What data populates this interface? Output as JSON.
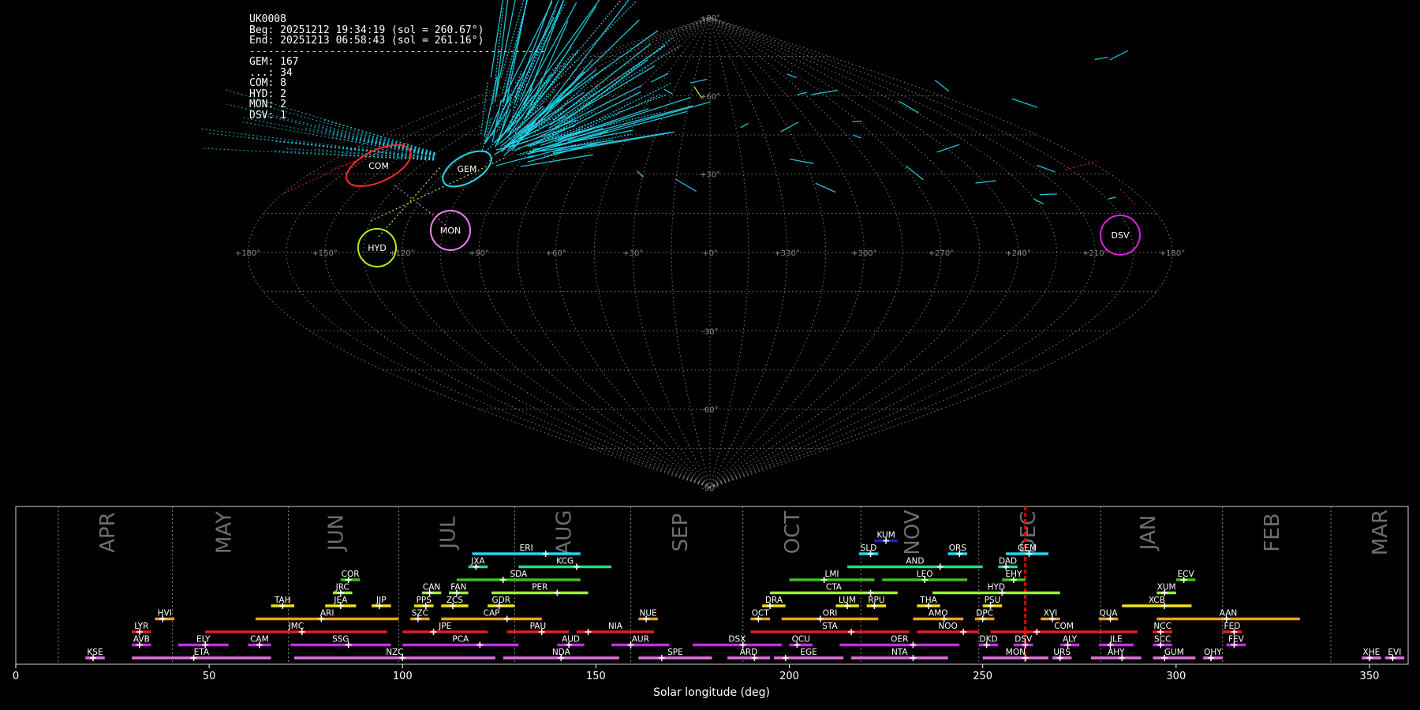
{
  "info": {
    "station": "UK0008",
    "begin": "Beg: 20251212 19:34:19 (sol = 260.67°)",
    "end": "End: 20251213 06:58:43 (sol = 261.16°)",
    "separator": "------------------------------------------------",
    "counts": [
      {
        "label": "GEM",
        "value": 167
      },
      {
        "label": "...",
        "value": 34
      },
      {
        "label": "COM",
        "value": 8
      },
      {
        "label": "HYD",
        "value": 2
      },
      {
        "label": "MON",
        "value": 2
      },
      {
        "label": "DSV",
        "value": 1
      }
    ]
  },
  "sky_map": {
    "projection": "sinusoidal",
    "ra_labels": [
      "+180°",
      "+150°",
      "+120°",
      "+90°",
      "+60°",
      "+30°",
      "+0°",
      "+330°",
      "+300°",
      "+270°",
      "+240°",
      "+210°",
      "+180°"
    ],
    "dec_labels": [
      "+90°",
      "+60°",
      "+30°",
      "-30°",
      "-60°",
      "-90°"
    ],
    "radiants": [
      {
        "name": "COM",
        "ra": 163,
        "dec": 32,
        "color": "#ff2a2a"
      },
      {
        "name": "GEM",
        "ra": 112,
        "dec": 32,
        "color": "#22d8f0"
      },
      {
        "name": "HYD",
        "ra": 130,
        "dec": 3,
        "color": "#b0f020"
      },
      {
        "name": "MON",
        "ra": 101,
        "dec": 9,
        "color": "#f080f0"
      },
      {
        "name": "DSV",
        "ra": 225,
        "dec": 7,
        "color": "#e020e0"
      }
    ],
    "colors": {
      "gem": "#22d8f0",
      "sporadic": "#ff2a2a",
      "hyd": "#c8f020",
      "mon": "#f070e0",
      "grid": "#9a9a9a"
    }
  },
  "chart_data": {
    "type": "timeline",
    "xlabel": "Solar longitude (deg)",
    "xlim": [
      0,
      360
    ],
    "x_ticks": [
      0,
      50,
      100,
      150,
      200,
      250,
      300,
      350
    ],
    "current_sol": 261,
    "months": [
      {
        "name": "APR",
        "start": 11,
        "label_at": 24
      },
      {
        "name": "MAY",
        "start": 40.5,
        "label_at": 54
      },
      {
        "name": "JUN",
        "start": 70.5,
        "label_at": 83
      },
      {
        "name": "JUL",
        "start": 99,
        "label_at": 112
      },
      {
        "name": "AUG",
        "start": 129,
        "label_at": 142
      },
      {
        "name": "SEP",
        "start": 159,
        "label_at": 172
      },
      {
        "name": "OCT",
        "start": 188,
        "label_at": 201
      },
      {
        "name": "NOV",
        "start": 218.5,
        "label_at": 232
      },
      {
        "name": "DEC",
        "start": 249,
        "label_at": 262
      },
      {
        "name": "JAN",
        "start": 280.5,
        "label_at": 293
      },
      {
        "name": "FEB",
        "start": 312,
        "label_at": 325
      },
      {
        "name": "MAR",
        "start": 340,
        "label_at": 353
      }
    ],
    "showers": [
      {
        "code": "KUM",
        "start": 222,
        "end": 228,
        "peak": 225,
        "level": 9,
        "color": "#2020e0"
      },
      {
        "code": "ERI",
        "start": 118,
        "end": 146,
        "peak": 137,
        "level": 8,
        "color": "#22d8f0"
      },
      {
        "code": "SLD",
        "start": 218,
        "end": 223,
        "peak": 221,
        "level": 8,
        "color": "#22d8f0"
      },
      {
        "code": "ORS",
        "start": 241,
        "end": 246,
        "peak": 244,
        "level": 8,
        "color": "#22d8f0"
      },
      {
        "code": "GEM",
        "start": 256,
        "end": 267,
        "peak": 262,
        "level": 8,
        "color": "#22d8f0"
      },
      {
        "code": "JXA",
        "start": 117,
        "end": 122,
        "peak": 119,
        "level": 7,
        "color": "#20e080"
      },
      {
        "code": "KCG",
        "start": 130,
        "end": 154,
        "peak": 145,
        "level": 7,
        "color": "#20e080"
      },
      {
        "code": "AND",
        "start": 215,
        "end": 250,
        "peak": 239,
        "level": 7,
        "color": "#20e080"
      },
      {
        "code": "DAD",
        "start": 254,
        "end": 259,
        "peak": 256,
        "level": 7,
        "color": "#20e080"
      },
      {
        "code": "COR",
        "start": 84,
        "end": 89,
        "peak": 86,
        "level": 6,
        "color": "#40c020"
      },
      {
        "code": "SDA",
        "start": 114,
        "end": 146,
        "peak": 126,
        "level": 6,
        "color": "#40c020"
      },
      {
        "code": "LMI",
        "start": 200,
        "end": 222,
        "peak": 209,
        "level": 6,
        "color": "#40c020"
      },
      {
        "code": "LEO",
        "start": 224,
        "end": 246,
        "peak": 235,
        "level": 6,
        "color": "#40c020"
      },
      {
        "code": "EHY",
        "start": 255,
        "end": 261,
        "peak": 258,
        "level": 6,
        "color": "#40c020"
      },
      {
        "code": "ECV",
        "start": 300,
        "end": 305,
        "peak": 302,
        "level": 6,
        "color": "#40c020"
      },
      {
        "code": "JRC",
        "start": 82,
        "end": 87,
        "peak": 84,
        "level": 5,
        "color": "#a0f030"
      },
      {
        "code": "CAN",
        "start": 105,
        "end": 110,
        "peak": 107,
        "level": 5,
        "color": "#a0f030"
      },
      {
        "code": "FAN",
        "start": 112,
        "end": 117,
        "peak": 114,
        "level": 5,
        "color": "#a0f030"
      },
      {
        "code": "PER",
        "start": 123,
        "end": 148,
        "peak": 140,
        "level": 5,
        "color": "#a0f030"
      },
      {
        "code": "CTA",
        "start": 195,
        "end": 228,
        "peak": 221,
        "level": 5,
        "color": "#a0f030"
      },
      {
        "code": "HYD",
        "start": 237,
        "end": 270,
        "peak": 255,
        "level": 5,
        "color": "#a0f030"
      },
      {
        "code": "XUM",
        "start": 295,
        "end": 300,
        "peak": 297,
        "level": 5,
        "color": "#a0f030"
      },
      {
        "code": "TAH",
        "start": 66,
        "end": 72,
        "peak": 69,
        "level": 4,
        "color": "#f0e020"
      },
      {
        "code": "JEA",
        "start": 80,
        "end": 88,
        "peak": 84,
        "level": 4,
        "color": "#f0e020"
      },
      {
        "code": "JIP",
        "start": 92,
        "end": 97,
        "peak": 94,
        "level": 4,
        "color": "#f0e020"
      },
      {
        "code": "PPS",
        "start": 103,
        "end": 108,
        "peak": 106,
        "level": 4,
        "color": "#f0e020"
      },
      {
        "code": "ZCS",
        "start": 110,
        "end": 117,
        "peak": 113,
        "level": 4,
        "color": "#f0e020"
      },
      {
        "code": "GDR",
        "start": 122,
        "end": 129,
        "peak": 125,
        "level": 4,
        "color": "#f0e020"
      },
      {
        "code": "DRA",
        "start": 193,
        "end": 199,
        "peak": 195,
        "level": 4,
        "color": "#f0e020"
      },
      {
        "code": "LUM",
        "start": 212,
        "end": 218,
        "peak": 215,
        "level": 4,
        "color": "#f0e020"
      },
      {
        "code": "RPU",
        "start": 220,
        "end": 225,
        "peak": 222,
        "level": 4,
        "color": "#f0e020"
      },
      {
        "code": "THA",
        "start": 233,
        "end": 239,
        "peak": 236,
        "level": 4,
        "color": "#f0e020"
      },
      {
        "code": "PSU",
        "start": 250,
        "end": 255,
        "peak": 252,
        "level": 4,
        "color": "#f0e020"
      },
      {
        "code": "XCB",
        "start": 286,
        "end": 304,
        "peak": 297,
        "level": 4,
        "color": "#f0e020"
      },
      {
        "code": "HVI",
        "start": 36,
        "end": 41,
        "peak": 38,
        "level": 3,
        "color": "#f0a020"
      },
      {
        "code": "ARI",
        "start": 62,
        "end": 99,
        "peak": 79,
        "level": 3,
        "color": "#f0a020"
      },
      {
        "code": "SZC",
        "start": 102,
        "end": 107,
        "peak": 104,
        "level": 3,
        "color": "#f0a020"
      },
      {
        "code": "CAP",
        "start": 110,
        "end": 136,
        "peak": 127,
        "level": 3,
        "color": "#f0a020"
      },
      {
        "code": "NUE",
        "start": 161,
        "end": 166,
        "peak": 163,
        "level": 3,
        "color": "#f0a020"
      },
      {
        "code": "OCT",
        "start": 190,
        "end": 195,
        "peak": 192,
        "level": 3,
        "color": "#f0a020"
      },
      {
        "code": "ORI",
        "start": 198,
        "end": 223,
        "peak": 208,
        "level": 3,
        "color": "#f0a020"
      },
      {
        "code": "AMO",
        "start": 232,
        "end": 245,
        "peak": 240,
        "level": 3,
        "color": "#f0a020"
      },
      {
        "code": "DPC",
        "start": 248,
        "end": 253,
        "peak": 250,
        "level": 3,
        "color": "#f0a020"
      },
      {
        "code": "XVI",
        "start": 265,
        "end": 270,
        "peak": 268,
        "level": 3,
        "color": "#f0a020"
      },
      {
        "code": "QUA",
        "start": 280,
        "end": 285,
        "peak": 283,
        "level": 3,
        "color": "#f0a020"
      },
      {
        "code": "AAN",
        "start": 295,
        "end": 332,
        "peak": 313,
        "level": 3,
        "color": "#f0a020"
      },
      {
        "code": "LYR",
        "start": 30,
        "end": 35,
        "peak": 32,
        "level": 2,
        "color": "#e02020"
      },
      {
        "code": "JMC",
        "start": 49,
        "end": 96,
        "peak": 74,
        "level": 2,
        "color": "#e02020"
      },
      {
        "code": "JPE",
        "start": 100,
        "end": 122,
        "peak": 108,
        "level": 2,
        "color": "#e02020"
      },
      {
        "code": "PAU",
        "start": 127,
        "end": 143,
        "peak": 136,
        "level": 2,
        "color": "#e02020"
      },
      {
        "code": "NIA",
        "start": 145,
        "end": 165,
        "peak": 148,
        "level": 2,
        "color": "#e02020"
      },
      {
        "code": "STA",
        "start": 190,
        "end": 231,
        "peak": 216,
        "level": 2,
        "color": "#e02020"
      },
      {
        "code": "NOO",
        "start": 233,
        "end": 249,
        "peak": 245,
        "level": 2,
        "color": "#e02020"
      },
      {
        "code": "COM",
        "start": 252,
        "end": 290,
        "peak": 264,
        "level": 2,
        "color": "#e02020"
      },
      {
        "code": "NCC",
        "start": 294,
        "end": 299,
        "peak": 296,
        "level": 2,
        "color": "#e02020"
      },
      {
        "code": "FED",
        "start": 312,
        "end": 317,
        "peak": 315,
        "level": 2,
        "color": "#e02020"
      },
      {
        "code": "AVB",
        "start": 30,
        "end": 35,
        "peak": 32,
        "level": 1,
        "color": "#c030e0"
      },
      {
        "code": "ELY",
        "start": 42,
        "end": 55,
        "peak": 49,
        "level": 1,
        "color": "#c030e0"
      },
      {
        "code": "CAM",
        "start": 60,
        "end": 66,
        "peak": 63,
        "level": 1,
        "color": "#c030e0"
      },
      {
        "code": "SSG",
        "start": 71,
        "end": 97,
        "peak": 86,
        "level": 1,
        "color": "#c030e0"
      },
      {
        "code": "PCA",
        "start": 100,
        "end": 130,
        "peak": 120,
        "level": 1,
        "color": "#c030e0"
      },
      {
        "code": "AUD",
        "start": 140,
        "end": 147,
        "peak": 143,
        "level": 1,
        "color": "#c030e0"
      },
      {
        "code": "AUR",
        "start": 154,
        "end": 169,
        "peak": 159,
        "level": 1,
        "color": "#c030e0"
      },
      {
        "code": "DSX",
        "start": 175,
        "end": 198,
        "peak": 188,
        "level": 1,
        "color": "#c030e0"
      },
      {
        "code": "OCU",
        "start": 200,
        "end": 206,
        "peak": 202,
        "level": 1,
        "color": "#c030e0"
      },
      {
        "code": "OER",
        "start": 213,
        "end": 244,
        "peak": 232,
        "level": 1,
        "color": "#c030e0"
      },
      {
        "code": "DKD",
        "start": 249,
        "end": 254,
        "peak": 251,
        "level": 1,
        "color": "#c030e0"
      },
      {
        "code": "DSV",
        "start": 258,
        "end": 263,
        "peak": 261,
        "level": 1,
        "color": "#c030e0"
      },
      {
        "code": "ALY",
        "start": 270,
        "end": 275,
        "peak": 272,
        "level": 1,
        "color": "#c030e0"
      },
      {
        "code": "JLE",
        "start": 280,
        "end": 289,
        "peak": 283,
        "level": 1,
        "color": "#c030e0"
      },
      {
        "code": "SCC",
        "start": 294,
        "end": 299,
        "peak": 296,
        "level": 1,
        "color": "#c030e0"
      },
      {
        "code": "FEV",
        "start": 313,
        "end": 318,
        "peak": 315,
        "level": 1,
        "color": "#c030e0"
      },
      {
        "code": "KSE",
        "start": 18,
        "end": 23,
        "peak": 20,
        "level": 0,
        "color": "#e070e0"
      },
      {
        "code": "ETA",
        "start": 30,
        "end": 66,
        "peak": 46,
        "level": 0,
        "color": "#e070e0"
      },
      {
        "code": "NZC",
        "start": 72,
        "end": 124,
        "peak": 100,
        "level": 0,
        "color": "#e070e0"
      },
      {
        "code": "NDA",
        "start": 126,
        "end": 156,
        "peak": 141,
        "level": 0,
        "color": "#e070e0"
      },
      {
        "code": "SPE",
        "start": 161,
        "end": 180,
        "peak": 167,
        "level": 0,
        "color": "#e070e0"
      },
      {
        "code": "ARD",
        "start": 184,
        "end": 195,
        "peak": 191,
        "level": 0,
        "color": "#e070e0"
      },
      {
        "code": "EGE",
        "start": 196,
        "end": 214,
        "peak": 199,
        "level": 0,
        "color": "#e070e0"
      },
      {
        "code": "NTA",
        "start": 216,
        "end": 241,
        "peak": 232,
        "level": 0,
        "color": "#e070e0"
      },
      {
        "code": "MON",
        "start": 250,
        "end": 267,
        "peak": 261,
        "level": 0,
        "color": "#e070e0"
      },
      {
        "code": "URS",
        "start": 268,
        "end": 273,
        "peak": 270,
        "level": 0,
        "color": "#e070e0"
      },
      {
        "code": "AHY",
        "start": 278,
        "end": 291,
        "peak": 286,
        "level": 0,
        "color": "#e070e0"
      },
      {
        "code": "GUM",
        "start": 294,
        "end": 305,
        "peak": 297,
        "level": 0,
        "color": "#e070e0"
      },
      {
        "code": "OHY",
        "start": 307,
        "end": 312,
        "peak": 309,
        "level": 0,
        "color": "#e070e0"
      },
      {
        "code": "XHE",
        "start": 348,
        "end": 353,
        "peak": 350,
        "level": 0,
        "color": "#e070e0"
      },
      {
        "code": "EVI",
        "start": 354,
        "end": 359,
        "peak": 356,
        "level": 0,
        "color": "#e070e0"
      }
    ]
  }
}
